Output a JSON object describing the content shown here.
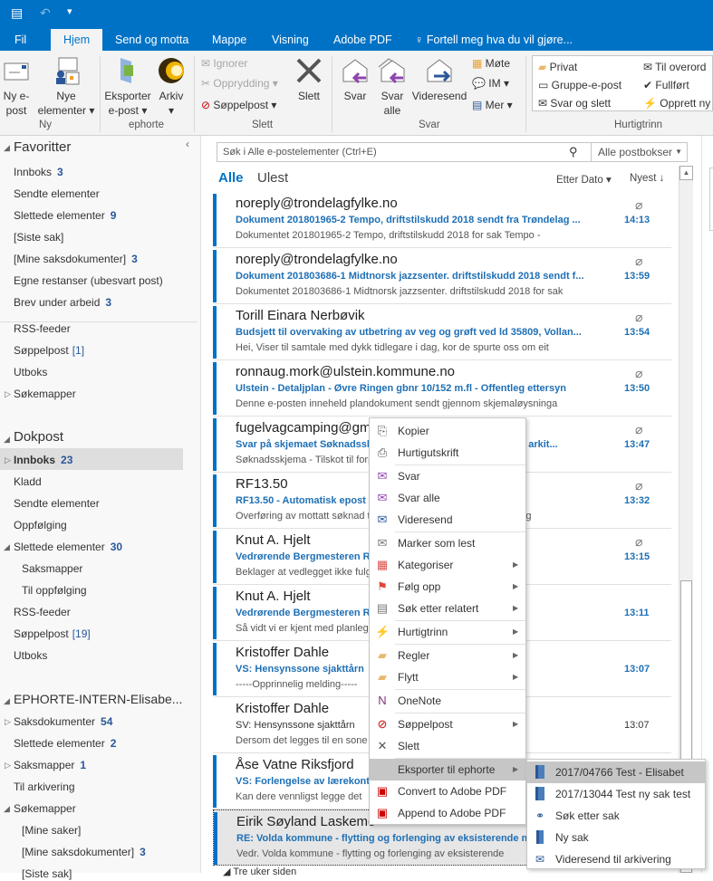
{
  "titlebar": {
    "undo": "↶",
    "customize": "▾"
  },
  "tabs": [
    "Fil",
    "Hjem",
    "Send og motta",
    "Mappe",
    "Visning",
    "Adobe PDF",
    "Fortell meg hva du vil gjøre..."
  ],
  "ribbon": {
    "ny": {
      "new_email": [
        "Ny e-",
        "post"
      ],
      "new_items": [
        "Nye",
        "elementer ▾"
      ],
      "group": "Ny"
    },
    "ephorte": {
      "export": [
        "Eksporter",
        "e-post ▾"
      ],
      "archive": [
        "Arkiv",
        "▾"
      ],
      "group": "ephorte"
    },
    "slett": {
      "ignore": "Ignorer",
      "cleanup": "Opprydding ▾",
      "junk": "Søppelpost ▾",
      "delete": "Slett",
      "group": "Slett"
    },
    "svar": {
      "reply": "Svar",
      "reply_all": [
        "Svar",
        "alle"
      ],
      "forward": "Videresend",
      "meeting": "Møte",
      "im": "IM ▾",
      "more": "Mer ▾",
      "group": "Svar"
    },
    "quicksteps": {
      "items": [
        "Privat",
        "Gruppe-e-post",
        "Svar og slett",
        "Til overord",
        "Fullført",
        "Opprett ny"
      ],
      "group": "Hurtigtrinn"
    }
  },
  "sidebar": {
    "favorites": {
      "title": "Favoritter",
      "items": [
        {
          "label": "Innboks",
          "count": "3"
        },
        {
          "label": "Sendte elementer",
          "count": ""
        },
        {
          "label": "Slettede elementer",
          "count": "9"
        },
        {
          "label": "[Siste sak]",
          "count": ""
        },
        {
          "label": "[Mine saksdokumenter]",
          "count": "3"
        },
        {
          "label": "Egne restanser (ubesvart post)",
          "count": ""
        },
        {
          "label": "Brev under arbeid",
          "count": "3"
        }
      ]
    },
    "misc": [
      {
        "label": "RSS-feeder",
        "badge": ""
      },
      {
        "label": "Søppelpost",
        "badge": "[1]"
      },
      {
        "label": "Utboks",
        "badge": ""
      },
      {
        "label": "Søkemapper",
        "badge": ""
      }
    ],
    "dokpost": {
      "title": "Dokpost",
      "items": [
        {
          "label": "Innboks",
          "count": "23"
        },
        {
          "label": "Kladd",
          "count": ""
        },
        {
          "label": "Sendte elementer",
          "count": ""
        },
        {
          "label": "Oppfølging",
          "count": ""
        },
        {
          "label": "Slettede elementer",
          "count": "30"
        },
        {
          "label": "Saksmapper",
          "count": ""
        },
        {
          "label": "Til oppfølging",
          "count": ""
        },
        {
          "label": "RSS-feeder",
          "count": ""
        },
        {
          "label": "Søppelpost",
          "badge": "[19]"
        },
        {
          "label": "Utboks",
          "count": ""
        }
      ]
    },
    "ephorte": {
      "title": "EPHORTE-INTERN-Elisabe...",
      "items": [
        {
          "label": "Saksdokumenter",
          "count": "54"
        },
        {
          "label": "Slettede elementer",
          "count": "2"
        },
        {
          "label": "Saksmapper",
          "count": "1"
        },
        {
          "label": "Til arkivering",
          "count": ""
        },
        {
          "label": "Søkemapper",
          "count": ""
        },
        {
          "label": "[Mine saker]",
          "count": ""
        },
        {
          "label": "[Mine saksdokumenter]",
          "count": "3"
        },
        {
          "label": "[Siste sak]",
          "count": ""
        }
      ]
    }
  },
  "search": {
    "placeholder": "Søk i Alle e-postelementer (Ctrl+E)",
    "scope": "Alle postbokser"
  },
  "filters": {
    "all": "Alle",
    "unread": "Ulest",
    "sort": "Etter Dato ▾",
    "order": "Nyest ↓"
  },
  "mails": [
    {
      "from": "noreply@trondelagfylke.no",
      "subject": "Dokument 201801965-2 Tempo, driftstilskudd 2018  sendt fra Trøndelag ...",
      "preview": "Dokumentet 201801965-2 Tempo, driftstilskudd 2018 for sak Tempo -",
      "time": "14:13",
      "attach": true,
      "unread": true
    },
    {
      "from": "noreply@trondelagfylke.no",
      "subject": "Dokument 201803686-1 Midtnorsk jazzsenter. driftstilskudd 2018 sendt f...",
      "preview": "Dokumentet 201803686-1 Midtnorsk jazzsenter. driftstilskudd 2018 for sak",
      "time": "13:59",
      "attach": true,
      "unread": true
    },
    {
      "from": "Torill Einara Nerbøvik",
      "subject": "Budsjett til overvaking av utbetring av veg og grøft ved ld 35809, Vollan...",
      "preview": "Hei,   Viser til samtale med dykk tidlegare i dag, kor de spurte oss om eit",
      "time": "13:54",
      "attach": true,
      "unread": true
    },
    {
      "from": "ronnaug.mork@ulstein.kommune.no",
      "subject": "Ulstein - Detaljplan - Øvre Ringen gbnr 10/152 m.fl - Offentleg ettersyn",
      "preview": "Denne e-posten inneheld plandokument sendt gjennom skjemaløysninga",
      "time": "13:50",
      "attach": true,
      "unread": true
    },
    {
      "from": "fugelvagcamping@gmail.com",
      "subject": "Svar på skjemaet Søknadsskjema - Tilskot til forprosjekt eller arkit...",
      "preview": "Søknadsskjema - Tilskot til forprosjekt - treng eg bistad",
      "time": "13:47",
      "attach": true,
      "unread": true
    },
    {
      "from": "RF13.50",
      "subject": "RF13.50 - Automatisk epost fra tilskuddsordning",
      "preview": "Overføring av mottatt søknad til tilskuddsordning med sakteordning",
      "time": "13:32",
      "attach": true,
      "unread": true
    },
    {
      "from": "Knut A. Hjelt",
      "subject": "Vedrørende Bergmesteren Raudsand mineraluttak og planer",
      "preview": "Beklager at vedlegget ikke fulgte med - her er det for mailen på",
      "time": "13:15",
      "attach": true,
      "unread": true
    },
    {
      "from": "Knut A. Hjelt",
      "subject": "Vedrørende Bergmesteren Raudsand mineraluttak og planer",
      "preview": "Så vidt vi er kjent med planleggingen",
      "time": "13:11",
      "attach": false,
      "unread": true
    },
    {
      "from": "Kristoffer Dahle",
      "subject": "VS: Hensynssone sjakttårn",
      "preview": "-----Opprinnelig melding-----",
      "time": "13:07",
      "attach": false,
      "unread": true
    },
    {
      "from": "Kristoffer Dahle",
      "subject": "SV: Hensynssone sjakttårn",
      "preview": "Dersom det legges til en sone",
      "time": "13:07",
      "attach": false,
      "unread": false
    },
    {
      "from": "Åse Vatne Riksfjord",
      "subject": "VS: Forlengelse av lærekontrakt",
      "preview": "Kan dere vennligst legge det",
      "time": "",
      "attach": true,
      "unread": true
    },
    {
      "from": "Eirik Søyland Laskemo",
      "subject": "RE: Volda kommune - flytting og forlenging av eksisterende m",
      "preview": "Vedr. Volda kommune - flytting og forlenging av eksisterende",
      "time": "",
      "attach": false,
      "unread": true
    }
  ],
  "group_header": "Tre uker siden",
  "context_menu": [
    {
      "label": "Kopier",
      "icon": "copy"
    },
    {
      "label": "Hurtigutskrift",
      "icon": "print"
    },
    {
      "label": "Svar",
      "icon": "reply"
    },
    {
      "label": "Svar alle",
      "icon": "reply-all"
    },
    {
      "label": "Videresend",
      "icon": "forward"
    },
    {
      "label": "Marker som lest",
      "icon": "envelope-open"
    },
    {
      "label": "Kategoriser",
      "icon": "categorize",
      "sub": true
    },
    {
      "label": "Følg opp",
      "icon": "flag",
      "sub": true
    },
    {
      "label": "Søk etter relatert",
      "icon": "document",
      "sub": true
    },
    {
      "label": "Hurtigtrinn",
      "icon": "lightning",
      "sub": true
    },
    {
      "label": "Regler",
      "icon": "rules",
      "sub": true
    },
    {
      "label": "Flytt",
      "icon": "move-folder",
      "sub": true
    },
    {
      "label": "OneNote",
      "icon": "onenote"
    },
    {
      "label": "Søppelpost",
      "icon": "junk",
      "sub": true
    },
    {
      "label": "Slett",
      "icon": "delete"
    },
    {
      "label": "Eksporter til ephorte",
      "icon": "",
      "sub": true
    },
    {
      "label": "Convert to Adobe PDF",
      "icon": "pdf"
    },
    {
      "label": "Append to Adobe PDF",
      "icon": "pdf"
    }
  ],
  "submenu": [
    {
      "label": "2017/04766 Test - Elisabet",
      "icon": "case-book"
    },
    {
      "label": "2017/13044 Test ny sak test",
      "icon": "case-book"
    },
    {
      "label": "Søk etter sak",
      "icon": "binoculars"
    },
    {
      "label": "Ny sak",
      "icon": "new-case"
    },
    {
      "label": "Videresend til arkivering",
      "icon": "forward-archive"
    }
  ]
}
